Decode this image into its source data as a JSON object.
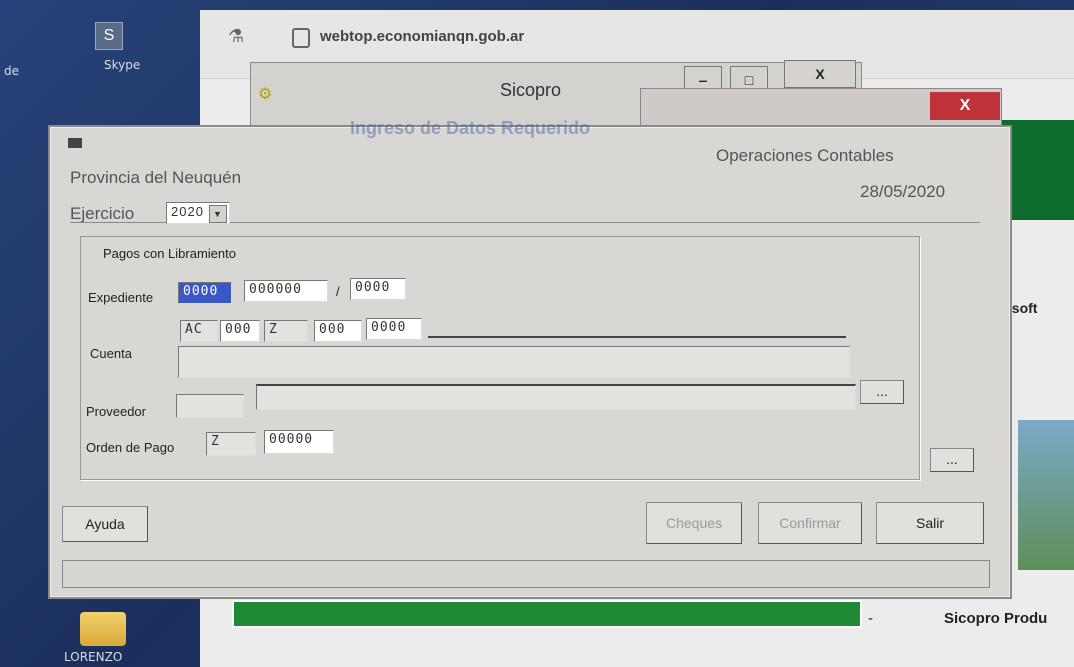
{
  "desktop": {
    "left_label": "de",
    "skype_label": "Skype",
    "folder_label": "LORENZO"
  },
  "browser": {
    "url": "webtop.economianqn.gob.ar",
    "right_text_1": "crosoft",
    "right_text_2": "Sicopro Produ",
    "dash": "-"
  },
  "bg_window": {
    "title": "Sicopro",
    "minimize": "‒",
    "maximize": "□",
    "close": "X"
  },
  "dialog": {
    "ghost_title": "Ingreso de Datos Requerido",
    "org": "Provincia del Neuquén",
    "module": "Operaciones Contables",
    "date": "28/05/2020",
    "ejercicio_label": "Ejercicio",
    "ejercicio_value": "2020",
    "group_title": "Pagos con Libramiento",
    "expediente_label": "Expediente",
    "expediente_1": "0000",
    "expediente_2": "000000",
    "expediente_sep": "/",
    "expediente_3": "0000",
    "cuenta_label": "Cuenta",
    "cuenta_1": "AC",
    "cuenta_2": "000",
    "cuenta_3": "Z",
    "cuenta_4": "000",
    "cuenta_5": "0000",
    "proveedor_label": "Proveedor",
    "orden_label": "Orden de Pago",
    "orden_1": "Z",
    "orden_2": "00000",
    "ellipsis": "...",
    "ayuda": "Ayuda",
    "cheques": "Cheques",
    "confirmar": "Confirmar",
    "salir": "Salir"
  }
}
